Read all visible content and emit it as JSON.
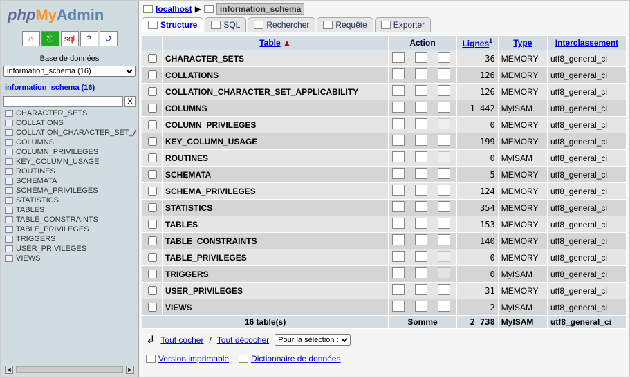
{
  "logo": {
    "php": "php",
    "my": "My",
    "admin": "Admin"
  },
  "sidebar": {
    "db_label": "Base de données",
    "db_selected": "information_schema (16)",
    "db_title": "information_schema (16)",
    "filter_x": "X",
    "tables": [
      "CHARACTER_SETS",
      "COLLATIONS",
      "COLLATION_CHARACTER_SET_APP",
      "COLUMNS",
      "COLUMN_PRIVILEGES",
      "KEY_COLUMN_USAGE",
      "ROUTINES",
      "SCHEMATA",
      "SCHEMA_PRIVILEGES",
      "STATISTICS",
      "TABLES",
      "TABLE_CONSTRAINTS",
      "TABLE_PRIVILEGES",
      "TRIGGERS",
      "USER_PRIVILEGES",
      "VIEWS"
    ]
  },
  "breadcrumb": {
    "server": "localhost",
    "arrow": "▶",
    "db": "information_schema"
  },
  "tabs": {
    "structure": "Structure",
    "sql": "SQL",
    "search": "Rechercher",
    "query": "Requête",
    "export": "Exporter"
  },
  "headers": {
    "table": "Table",
    "sort": "▲",
    "action": "Action",
    "rows": "Lignes",
    "rows_sup": "1",
    "type": "Type",
    "collation": "Interclassement"
  },
  "rows": [
    {
      "name": "CHARACTER_SETS",
      "rows": "36",
      "type": "MEMORY",
      "coll": "utf8_general_ci",
      "drop": true
    },
    {
      "name": "COLLATIONS",
      "rows": "126",
      "type": "MEMORY",
      "coll": "utf8_general_ci",
      "drop": true
    },
    {
      "name": "COLLATION_CHARACTER_SET_APPLICABILITY",
      "rows": "126",
      "type": "MEMORY",
      "coll": "utf8_general_ci",
      "drop": true
    },
    {
      "name": "COLUMNS",
      "rows": "1 442",
      "type": "MyISAM",
      "coll": "utf8_general_ci",
      "drop": true
    },
    {
      "name": "COLUMN_PRIVILEGES",
      "rows": "0",
      "type": "MEMORY",
      "coll": "utf8_general_ci",
      "drop": false
    },
    {
      "name": "KEY_COLUMN_USAGE",
      "rows": "199",
      "type": "MEMORY",
      "coll": "utf8_general_ci",
      "drop": true
    },
    {
      "name": "ROUTINES",
      "rows": "0",
      "type": "MyISAM",
      "coll": "utf8_general_ci",
      "drop": false
    },
    {
      "name": "SCHEMATA",
      "rows": "5",
      "type": "MEMORY",
      "coll": "utf8_general_ci",
      "drop": true
    },
    {
      "name": "SCHEMA_PRIVILEGES",
      "rows": "124",
      "type": "MEMORY",
      "coll": "utf8_general_ci",
      "drop": true
    },
    {
      "name": "STATISTICS",
      "rows": "354",
      "type": "MEMORY",
      "coll": "utf8_general_ci",
      "drop": true
    },
    {
      "name": "TABLES",
      "rows": "153",
      "type": "MEMORY",
      "coll": "utf8_general_ci",
      "drop": true
    },
    {
      "name": "TABLE_CONSTRAINTS",
      "rows": "140",
      "type": "MEMORY",
      "coll": "utf8_general_ci",
      "drop": true
    },
    {
      "name": "TABLE_PRIVILEGES",
      "rows": "0",
      "type": "MEMORY",
      "coll": "utf8_general_ci",
      "drop": false
    },
    {
      "name": "TRIGGERS",
      "rows": "0",
      "type": "MyISAM",
      "coll": "utf8_general_ci",
      "drop": false
    },
    {
      "name": "USER_PRIVILEGES",
      "rows": "31",
      "type": "MEMORY",
      "coll": "utf8_general_ci",
      "drop": true
    },
    {
      "name": "VIEWS",
      "rows": "2",
      "type": "MyISAM",
      "coll": "utf8_general_ci",
      "drop": true
    }
  ],
  "summary": {
    "count": "16 table(s)",
    "label": "Somme",
    "rows": "2 738",
    "type": "MyISAM",
    "coll": "utf8_general_ci"
  },
  "toolbar2": {
    "check_all": "Tout cocher",
    "uncheck_all": "Tout décocher",
    "sep": " / ",
    "with_selected": "Pour la sélection :"
  },
  "footer": {
    "print": "Version imprimable",
    "dict": "Dictionnaire de données"
  }
}
